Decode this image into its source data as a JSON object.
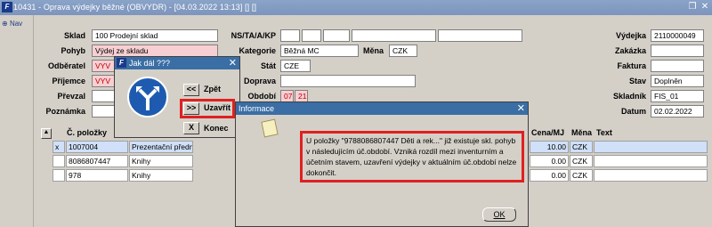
{
  "window": {
    "title": "10431 - Oprava výdejky běžné (OBVYDR) - [04.03.2022 13:13] [] []"
  },
  "nav": {
    "label": "Nav"
  },
  "form": {
    "sklad_label": "Sklad",
    "sklad_value": "100 Prodejní sklad",
    "pohyb_label": "Pohyb",
    "pohyb_value": "Výdej ze skladu",
    "odberatel_label": "Odběratel",
    "odberatel_value": "VYV",
    "prijemce_label": "Příjemce",
    "prijemce_value": "VYV",
    "prevzal_label": "Převzal",
    "poznamka_label": "Poznámka",
    "nsta_label": "NS/TA/A/KP",
    "kategorie_label": "Kategorie",
    "kategorie_value": "Běžná MC",
    "mena_label": "Měna",
    "mena_value": "CZK",
    "stat_label": "Stát",
    "stat_value": "CZE",
    "doprava_label": "Doprava",
    "obdobi_label": "Období",
    "obdobi_value1": "07",
    "obdobi_value2": "21",
    "vydejka_label": "Výdejka",
    "vydejka_value": "2110000049",
    "zakazka_label": "Zakázka",
    "faktura_label": "Faktura",
    "stav_label": "Stav",
    "stav_value": "Doplněn",
    "skladnik_label": "Skladník",
    "skladnik_value": "FIS_01",
    "datum_label": "Datum",
    "datum_value": "02.02.2022"
  },
  "table": {
    "col_cislo": "Č. položky",
    "col_cena": "Cena/MJ",
    "col_mena": "Měna",
    "col_text": "Text",
    "rows": [
      {
        "mark": "x",
        "cislo": "1007004",
        "nazev": "Prezentační předn",
        "cena": "10.00",
        "mena": "CZK"
      },
      {
        "mark": "",
        "cislo": "8086807447",
        "nazev": "Knihy",
        "cena": "0.00",
        "mena": "CZK"
      },
      {
        "mark": "",
        "cislo": "978",
        "nazev": "Knihy",
        "cena": "0.00",
        "mena": "CZK"
      }
    ]
  },
  "dialog_jak": {
    "title": "Jak dál ???",
    "zpet_symbol": "<<",
    "zpet_label": "Zpět",
    "uzavrit_symbol": ">>",
    "uzavrit_label": "Uzavřít",
    "konec_symbol": "X",
    "konec_label": "Konec"
  },
  "dialog_info": {
    "title": "Informace",
    "message": "U položky \"9788086807447 Děti a rek...\" již existuje skl. pohyb v následujícím úč.období. Vzniká rozdíl mezi inventurním a účetním stavem, uzavření výdejky v aktuálním úč.období nelze dokončit.",
    "ok_label": "OK"
  },
  "colors": {
    "highlight": "#e02020",
    "titlebar": "#7d95bd",
    "dialog_title": "#3a6ea5"
  }
}
